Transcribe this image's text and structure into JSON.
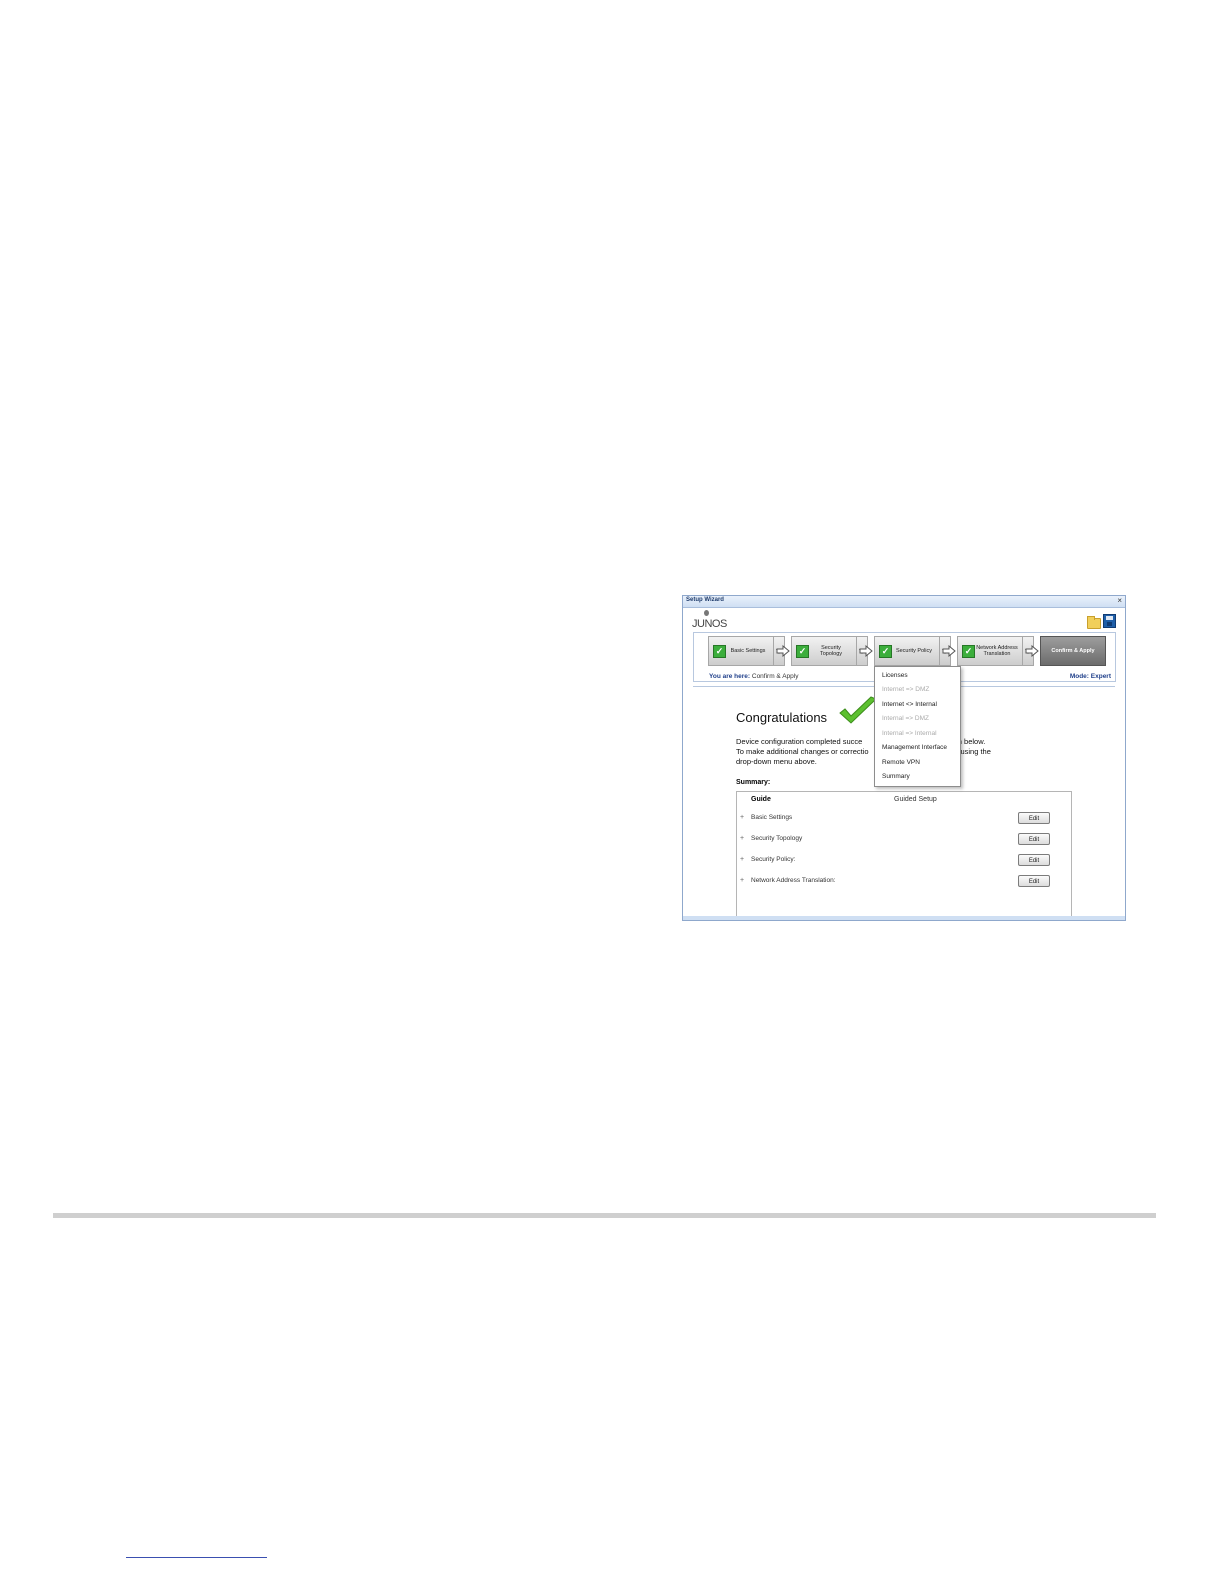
{
  "window": {
    "title": "Setup Wizard",
    "close_glyph": "×"
  },
  "brand": {
    "name": "JUNOS"
  },
  "toolbar": {
    "open_icon": "folder-icon",
    "save_icon": "save-icon"
  },
  "steps": [
    {
      "label": "Basic Settings",
      "status": "complete"
    },
    {
      "label": "Security Topology",
      "status": "complete"
    },
    {
      "label": "Security Policy",
      "status": "complete"
    },
    {
      "label": "Network Address Translation",
      "status": "complete"
    },
    {
      "label": "Confirm & Apply",
      "status": "current"
    }
  ],
  "breadcrumb": {
    "prefix": "You are here:",
    "value": "Confirm & Apply"
  },
  "mode": "Mode: Expert",
  "dropdown_menu": [
    {
      "label": "Licenses",
      "enabled": true
    },
    {
      "label": "Internet => DMZ",
      "enabled": false
    },
    {
      "label": "Internet <> Internal",
      "enabled": true
    },
    {
      "label": "Internal => DMZ",
      "enabled": false
    },
    {
      "label": "Internal => Internal",
      "enabled": false
    },
    {
      "label": "Management Interface",
      "enabled": true
    },
    {
      "label": "Remote VPN",
      "enabled": true
    },
    {
      "label": "Summary",
      "enabled": true
    }
  ],
  "main": {
    "heading": "Congratulations",
    "description_line1": "Device configuration completed succe",
    "description_line1_tail": "your configuration below.",
    "description_line2": "To make additional changes or correctio",
    "description_line2_tail": "ponding area using the",
    "description_line3": "drop-down menu above.",
    "summary_label": "Summary:"
  },
  "summary": {
    "col_guide": "Guide",
    "col_setup": "Guided Setup",
    "rows": [
      {
        "name": "Basic Settings",
        "edit": "Edit"
      },
      {
        "name": "Security Topology",
        "edit": "Edit"
      },
      {
        "name": "Security Policy:",
        "edit": "Edit"
      },
      {
        "name": "Network Address Translation:",
        "edit": "Edit"
      }
    ]
  },
  "colors": {
    "accent": "#1f3f8a",
    "check_green": "#3cae3c",
    "title_bar": "#cfdff3"
  }
}
